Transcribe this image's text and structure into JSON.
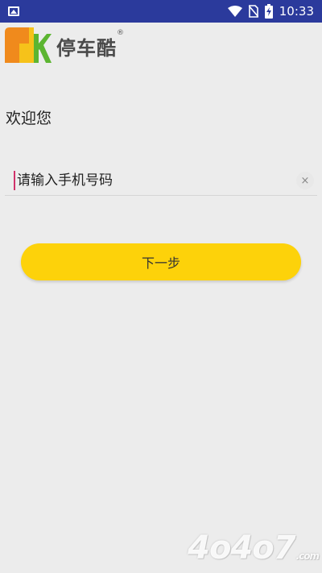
{
  "status_bar": {
    "time": "10:33",
    "icons": [
      "gallery-icon",
      "wifi-icon",
      "no-sim-icon",
      "battery-charging-icon"
    ]
  },
  "logo": {
    "text": "停车酷",
    "reg_mark": "®",
    "colors": {
      "orange": "#f08a1c",
      "yellow": "#f6c21a",
      "green": "#5cb531"
    }
  },
  "welcome": {
    "text": "欢迎您"
  },
  "phone_field": {
    "placeholder": "请输入手机号码",
    "value": "",
    "clear_symbol": "×"
  },
  "next_button": {
    "label": "下一步"
  },
  "watermark": {
    "text": "4o4o7",
    "suffix": ".com"
  },
  "colors": {
    "status_bar": "#2b3a9c",
    "background": "#ececec",
    "button": "#fdd20a",
    "caret": "#d0326a"
  }
}
